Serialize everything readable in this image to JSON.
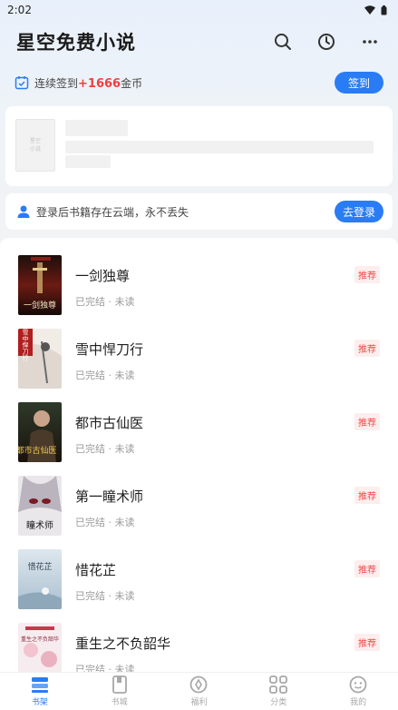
{
  "status_bar": {
    "time": "2:02"
  },
  "header": {
    "title": "星空免费小说"
  },
  "checkin": {
    "prefix": "连续签到",
    "coins": "+1666",
    "suffix": "金币",
    "button": "签到"
  },
  "recent_placeholder": {
    "cover_text_line1": "星空",
    "cover_text_line2": "小说"
  },
  "login_banner": {
    "text": "登录后书籍存在云端，永不丢失",
    "button": "去登录"
  },
  "books": [
    {
      "title": "一剑独尊",
      "status": "已完结",
      "progress": "未读",
      "tag": "推荐",
      "cover_text": "一剑独尊"
    },
    {
      "title": "雪中悍刀行",
      "status": "已完结",
      "progress": "未读",
      "tag": "推荐",
      "cover_text": "雪中悍刀行"
    },
    {
      "title": "都市古仙医",
      "status": "已完结",
      "progress": "未读",
      "tag": "推荐",
      "cover_text": "都市古仙医"
    },
    {
      "title": "第一瞳术师",
      "status": "已完结",
      "progress": "未读",
      "tag": "推荐",
      "cover_text": "瞳术师"
    },
    {
      "title": "惜花芷",
      "status": "已完结",
      "progress": "未读",
      "tag": "推荐",
      "cover_text": "惜花芷"
    },
    {
      "title": "重生之不负韶华",
      "status": "已完结",
      "progress": "未读",
      "tag": "推荐",
      "cover_text": "重生之不负韶华"
    }
  ],
  "bottom_nav": [
    {
      "label": "书架",
      "icon": "bookshelf-icon",
      "active": true
    },
    {
      "label": "书城",
      "icon": "bookstore-icon",
      "active": false
    },
    {
      "label": "福利",
      "icon": "welfare-icon",
      "active": false
    },
    {
      "label": "分类",
      "icon": "category-icon",
      "active": false
    },
    {
      "label": "我的",
      "icon": "profile-icon",
      "active": false
    }
  ],
  "colors": {
    "accent": "#2a7cf4",
    "coin_red": "#f23d3d",
    "tag_bg": "#fdeeee",
    "tag_text": "#f04a4a"
  }
}
